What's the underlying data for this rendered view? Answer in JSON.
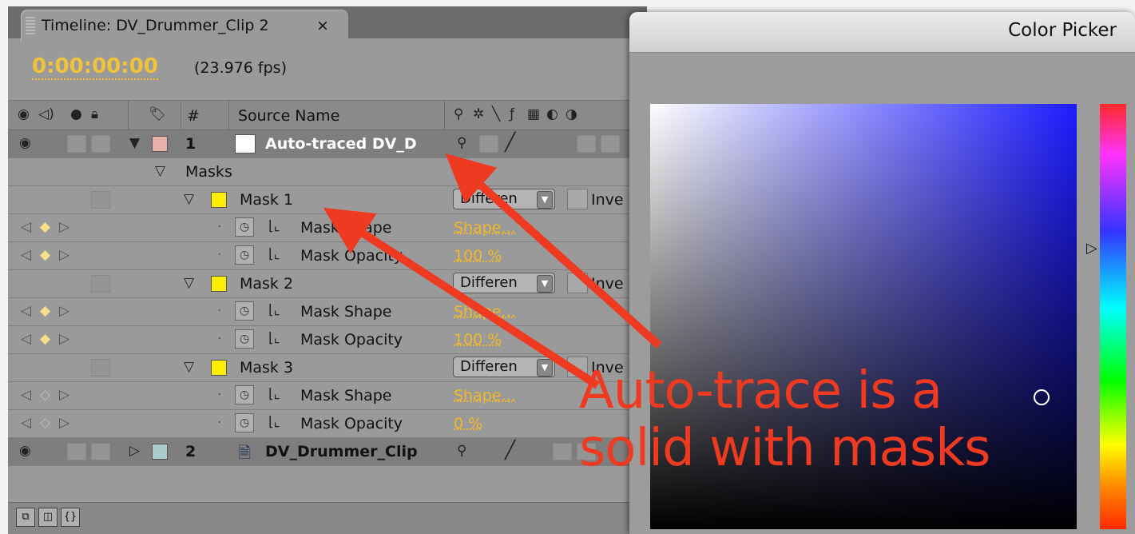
{
  "timeline": {
    "tab_title": "Timeline: DV_Drummer_Clip 2",
    "tab_close": "×",
    "timecode": "0:00:00:00",
    "fps": "(23.976 fps)",
    "header": {
      "number": "#",
      "source_name": "Source Name"
    },
    "layers": [
      {
        "index": "1",
        "name": "Auto-traced DV_D",
        "label_color": "#e8b0a8"
      },
      {
        "index": "2",
        "name": "DV_Drummer_Clip",
        "label_color": "#aacccc"
      }
    ],
    "masks_group": "Masks",
    "masks": [
      {
        "name": "Mask 1",
        "mode": "Differen",
        "invert": "Inve",
        "shape_label": "Mask Shape",
        "shape_value": "Shape...",
        "opacity_label": "Mask Opacity",
        "opacity_value": "100 %"
      },
      {
        "name": "Mask 2",
        "mode": "Differen",
        "invert": "Inve",
        "shape_label": "Mask Shape",
        "shape_value": "Shape...",
        "opacity_label": "Mask Opacity",
        "opacity_value": "100 %"
      },
      {
        "name": "Mask 3",
        "mode": "Differen",
        "invert": "Inve",
        "shape_label": "Mask Shape",
        "shape_value": "Shape...",
        "opacity_label": "Mask Opacity",
        "opacity_value": "0 %"
      }
    ],
    "mask_label_color": "#ffee00"
  },
  "color_picker": {
    "title": "Color Picker",
    "field_hue_color": "#1d1cff"
  },
  "annotation": {
    "line1": "Auto-trace is a",
    "line2": "solid with masks",
    "color": "#ee3a21"
  }
}
